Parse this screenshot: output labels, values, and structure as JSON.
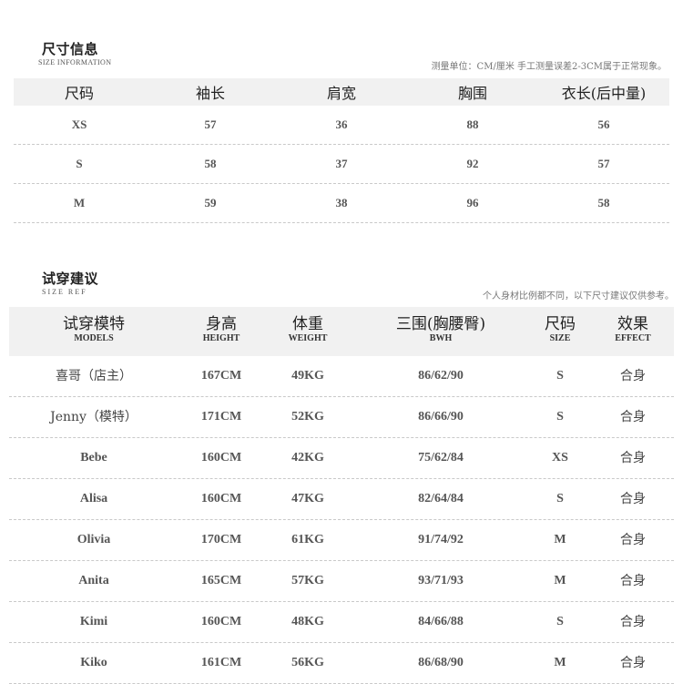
{
  "size_info": {
    "title": "尺寸信息",
    "subtitle": "SIZE INFORMATION",
    "note": "测量单位：CM/厘米  手工测量误差2-3CM属于正常现象。",
    "headers": [
      "尺码",
      "袖长",
      "肩宽",
      "胸围",
      "衣长(后中量)"
    ],
    "rows": [
      [
        "XS",
        "57",
        "36",
        "88",
        "56"
      ],
      [
        "S",
        "58",
        "37",
        "92",
        "57"
      ],
      [
        "M",
        "59",
        "38",
        "96",
        "58"
      ]
    ]
  },
  "try_ref": {
    "title": "试穿建议",
    "subtitle": "SIZE  REF",
    "note": "个人身材比例都不同，以下尺寸建议仅供参考。",
    "headers": [
      {
        "cn": "试穿模特",
        "en": "MODELS"
      },
      {
        "cn": "身高",
        "en": "HEIGHT"
      },
      {
        "cn": "体重",
        "en": "WEIGHT"
      },
      {
        "cn": "三围(胸腰臀)",
        "en": "BWH"
      },
      {
        "cn": "尺码",
        "en": "SIZE"
      },
      {
        "cn": "效果",
        "en": "EFFECT"
      }
    ],
    "rows": [
      [
        "喜哥（店主）",
        "167CM",
        "49KG",
        "86/62/90",
        "S",
        "合身"
      ],
      [
        "Jenny（模特）",
        "171CM",
        "52KG",
        "86/66/90",
        "S",
        "合身"
      ],
      [
        "Bebe",
        "160CM",
        "42KG",
        "75/62/84",
        "XS",
        "合身"
      ],
      [
        "Alisa",
        "160CM",
        "47KG",
        "82/64/84",
        "S",
        "合身"
      ],
      [
        "Olivia",
        "170CM",
        "61KG",
        "91/74/92",
        "M",
        "合身"
      ],
      [
        "Anita",
        "165CM",
        "57KG",
        "93/71/93",
        "M",
        "合身"
      ],
      [
        "Kimi",
        "160CM",
        "48KG",
        "84/66/88",
        "S",
        "合身"
      ],
      [
        "Kiko",
        "161CM",
        "56KG",
        "86/68/90",
        "M",
        "合身"
      ]
    ]
  }
}
